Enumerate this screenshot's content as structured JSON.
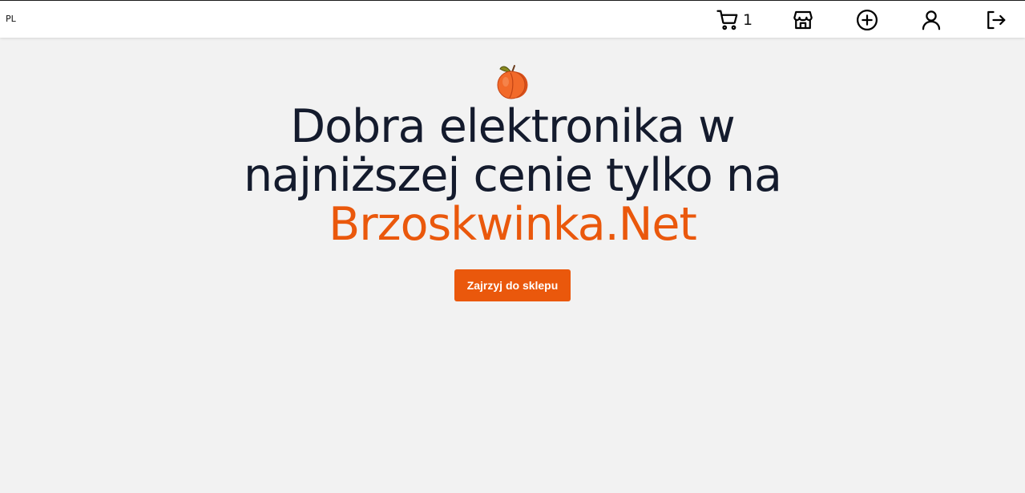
{
  "header": {
    "language": "PL",
    "cart_count": "1",
    "icons": [
      "cart-icon",
      "store-icon",
      "add-circle-icon",
      "user-icon",
      "logout-icon"
    ]
  },
  "hero": {
    "logo_icon": "peach-icon",
    "headline_line1": "Dobra elektronika w",
    "headline_line2": "najniższej cenie tylko na",
    "brand_name": "Brzoskwinka.Net",
    "cta_label": "Zajrzyj do sklepu"
  },
  "colors": {
    "accent": "#ea580c",
    "headline": "#141b2d",
    "background": "#f2f2f2",
    "topbar": "#ffffff"
  }
}
